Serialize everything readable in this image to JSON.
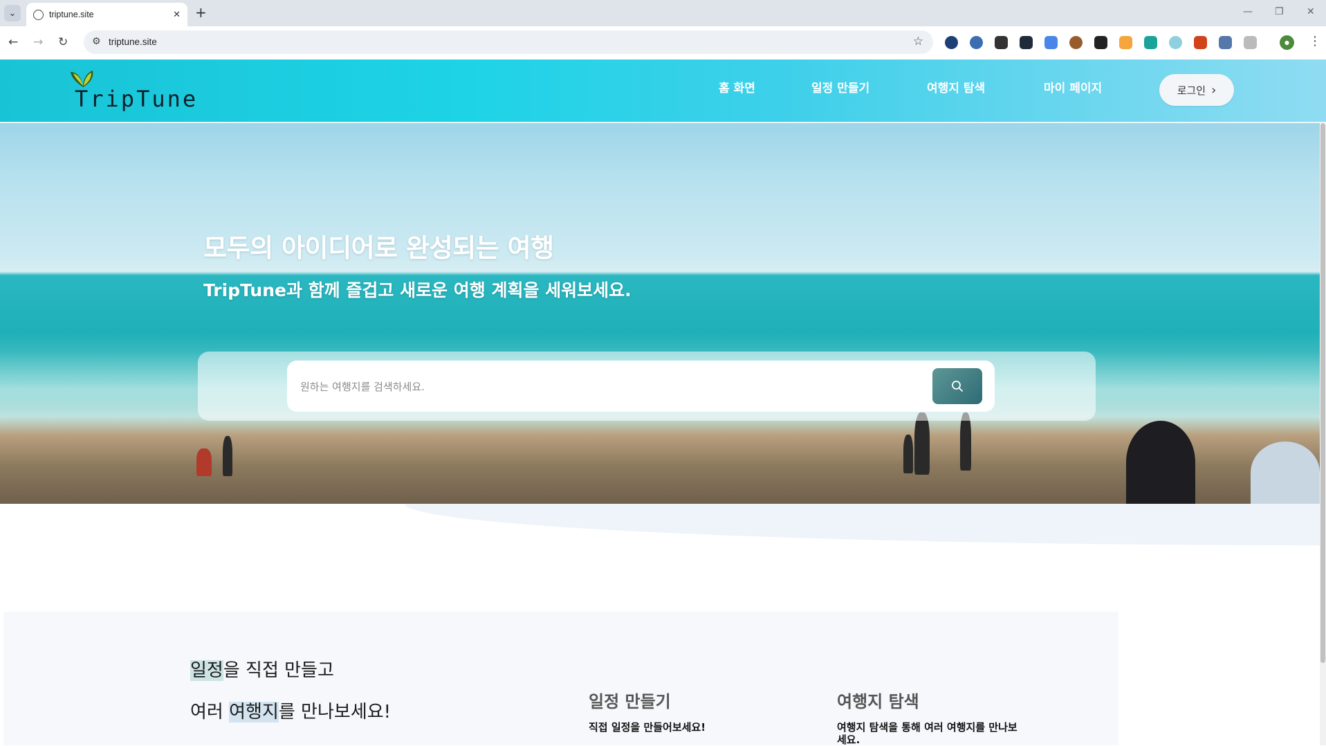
{
  "browser": {
    "tab_title": "triptune.site",
    "url": "triptune.site",
    "new_tab": "+",
    "tab_close": "✕"
  },
  "site": {
    "logo_text": "TripTune",
    "nav": [
      "홈 화면",
      "일정 만들기",
      "여행지 탐색",
      "마이 페이지"
    ],
    "login_label": "로그인"
  },
  "hero": {
    "title": "모두의 아이디어로 완성되는 여행",
    "subtitle": "TripTune과 함께 즐겁고 새로운 여행 계획을 세워보세요.",
    "search_placeholder": "원하는 여행지를 검색하세요."
  },
  "features": {
    "line1_hl": "일정",
    "line1_rest": "을 직접 만들고",
    "line2_pre": "여러 ",
    "line2_hl": "여행지",
    "line2_rest": "를 만나보세요!",
    "cards": [
      {
        "title": "일정 만들기",
        "desc": "직접 일정을 만들어보세요!"
      },
      {
        "title": "여행지 탐색",
        "desc": "여행지 탐색을 통해 여러 여행지를 만나보세요."
      }
    ]
  },
  "colors": {
    "header_gradient_start": "#19c3d6",
    "search_button": "#2e6b74"
  }
}
